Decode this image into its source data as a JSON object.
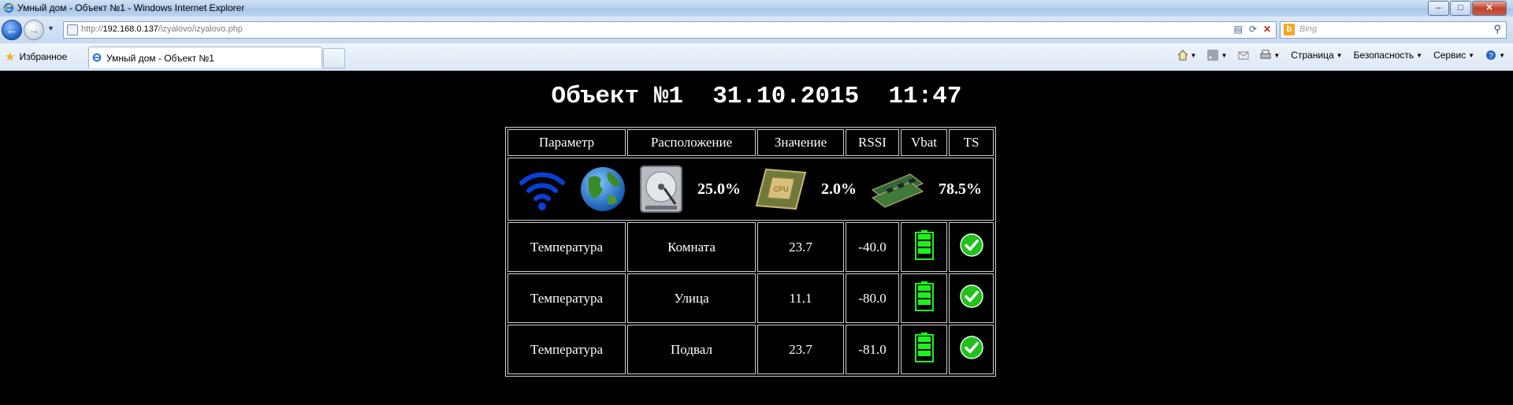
{
  "window": {
    "title": "Умный дом - Объект №1 - Windows Internet Explorer"
  },
  "address": {
    "url_prefix": "http://",
    "url_host": "192.168.0.137",
    "url_path": "/izyalovo/izyalovo.php"
  },
  "search": {
    "placeholder": "Bing",
    "engine_icon": "b"
  },
  "favorites": {
    "label": "Избранное"
  },
  "tab": {
    "label": "Умный дом - Объект №1"
  },
  "commands": {
    "page": "Страница",
    "security": "Безопасность",
    "service": "Сервис"
  },
  "heading": {
    "object": "Объект №1",
    "date": "31.10.2015",
    "time": "11:47"
  },
  "table": {
    "headers": {
      "param": "Параметр",
      "location": "Расположение",
      "value": "Значение",
      "rssi": "RSSI",
      "vbat": "Vbat",
      "ts": "TS"
    },
    "system": {
      "hdd": "25.0%",
      "cpu": "2.0%",
      "ram": "78.5%",
      "cpu_chip_label": "CPU"
    },
    "rows": [
      {
        "param": "Температура",
        "location": "Комната",
        "value": "23.7",
        "rssi": "-40.0",
        "battery_level": 1.0,
        "ts_status": "ok"
      },
      {
        "param": "Температура",
        "location": "Улица",
        "value": "11.1",
        "rssi": "-80.0",
        "battery_level": 1.0,
        "ts_status": "ok"
      },
      {
        "param": "Температура",
        "location": "Подвал",
        "value": "23.7",
        "rssi": "-81.0",
        "battery_level": 1.0,
        "ts_status": "ok"
      }
    ]
  },
  "colors": {
    "page_bg": "#000000",
    "battery_green": "#1cf21c",
    "ok_green": "#22c01c",
    "wifi_blue": "#0a3fd6"
  }
}
